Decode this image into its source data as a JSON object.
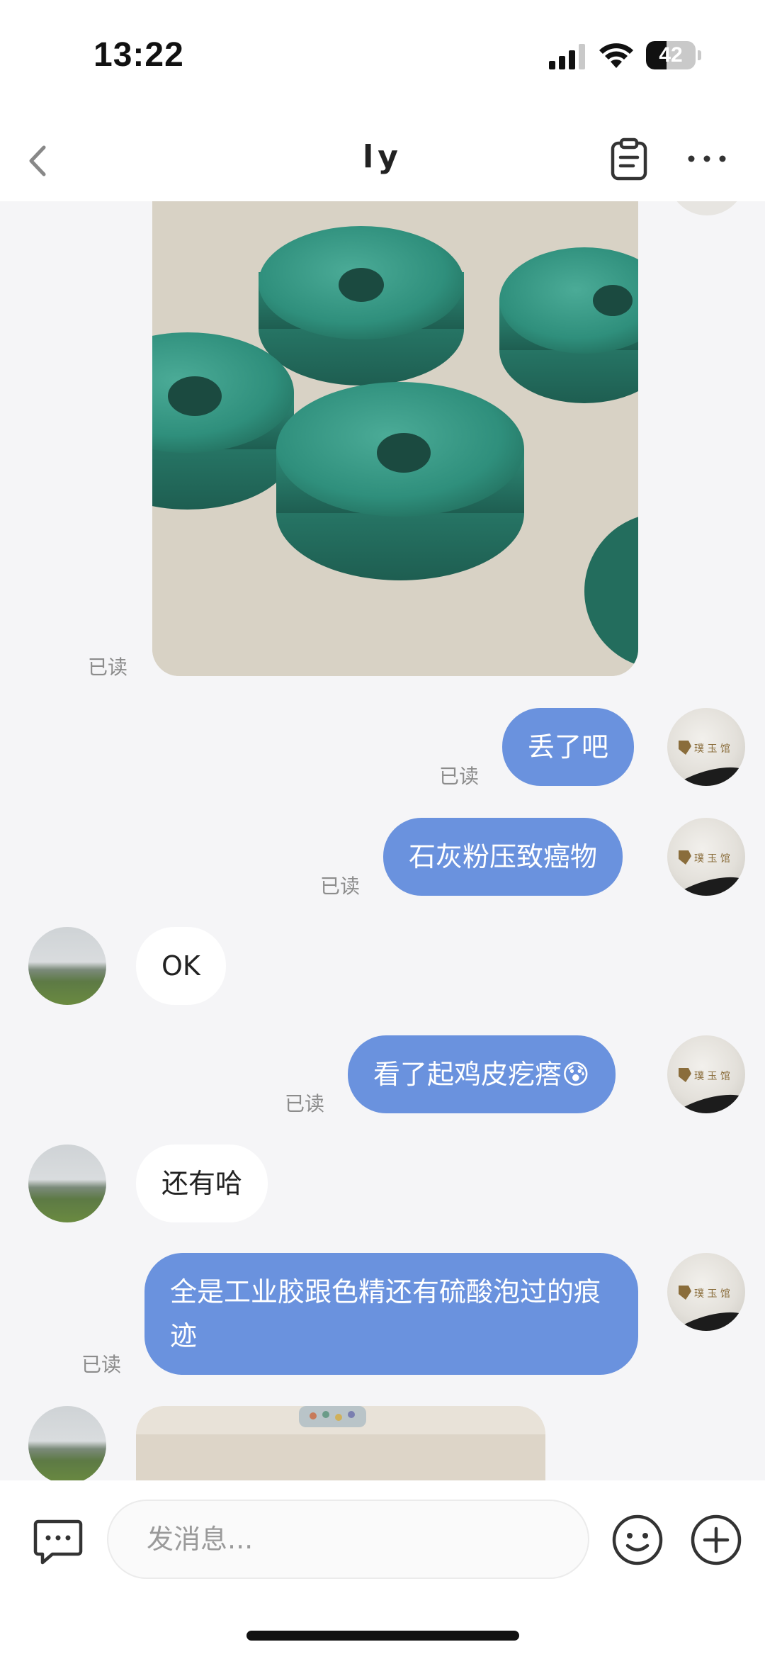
{
  "status": {
    "time": "13:22",
    "battery": "42",
    "battery_level": 0.42
  },
  "header": {
    "title": "ly"
  },
  "messages": [
    {
      "side": "out",
      "type": "image",
      "status": "已读"
    },
    {
      "side": "out",
      "type": "text",
      "text": "丢了吧",
      "status": "已读"
    },
    {
      "side": "out",
      "type": "text",
      "text": "石灰粉压致癌物",
      "status": "已读"
    },
    {
      "side": "in",
      "type": "text",
      "text": "OK"
    },
    {
      "side": "out",
      "type": "text",
      "text": "看了起鸡皮疙瘩😰",
      "status": "已读"
    },
    {
      "side": "in",
      "type": "text",
      "text": "还有哈"
    },
    {
      "side": "out",
      "type": "text",
      "text": "全是工业胶跟色精还有硫酸泡过的痕迹",
      "status": "已读"
    },
    {
      "side": "in",
      "type": "image"
    }
  ],
  "composer": {
    "placeholder": "发消息..."
  },
  "icons": {
    "back": "chevron-left-icon",
    "notes": "clipboard-icon",
    "more": "more-dots-icon",
    "voice": "message-toggle-icon",
    "emoji": "emoji-icon",
    "plus": "plus-icon"
  },
  "colors": {
    "outgoing_bubble": "#6a92de",
    "incoming_bubble": "#ffffff",
    "background": "#f5f5f7"
  }
}
